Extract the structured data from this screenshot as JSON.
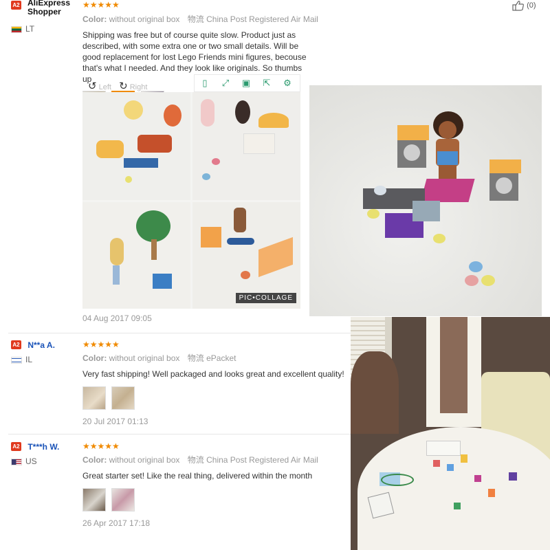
{
  "helpful": {
    "count": "(0)"
  },
  "viewer": {
    "left_label": "Left",
    "right_label": "Right",
    "watermark": "PIC•COLLAGE"
  },
  "reviews": [
    {
      "badge": "A2",
      "name": "AliExpress Shopper",
      "country": "LT",
      "stars": "★★★★★",
      "color_label": "Color:",
      "color_value": "without original box",
      "logistics_label": "物流",
      "logistics_value": "China Post Registered Air Mail",
      "text": "Shipping was free but of course quite slow. Product just as described, with some extra one or two small details. Will be good replacement for lost Lego Friends mini figures, becouse that's what I needed. And they look like originals. So thumbs up",
      "date": "04 Aug 2017 09:05"
    },
    {
      "badge": "A2",
      "name": "N**a A.",
      "country": "IL",
      "stars": "★★★★★",
      "color_label": "Color:",
      "color_value": "without original box",
      "logistics_label": "物流",
      "logistics_value": "ePacket",
      "text": "Very fast shipping! Well packaged and looks great and excellent quality!",
      "date": "20 Jul 2017 01:13"
    },
    {
      "badge": "A2",
      "name": "T***h W.",
      "country": "US",
      "stars": "★★★★★",
      "color_label": "Color:",
      "color_value": "without original box",
      "logistics_label": "物流",
      "logistics_value": "China Post Registered Air Mail",
      "text": "Great starter set! Like the real thing, delivered within the month",
      "date": "26 Apr 2017 17:18"
    }
  ],
  "colors": {
    "accent": "#f08a00",
    "link": "#1a53b8",
    "badge": "#e03a1e",
    "tool_icon": "#2a9a6e"
  }
}
